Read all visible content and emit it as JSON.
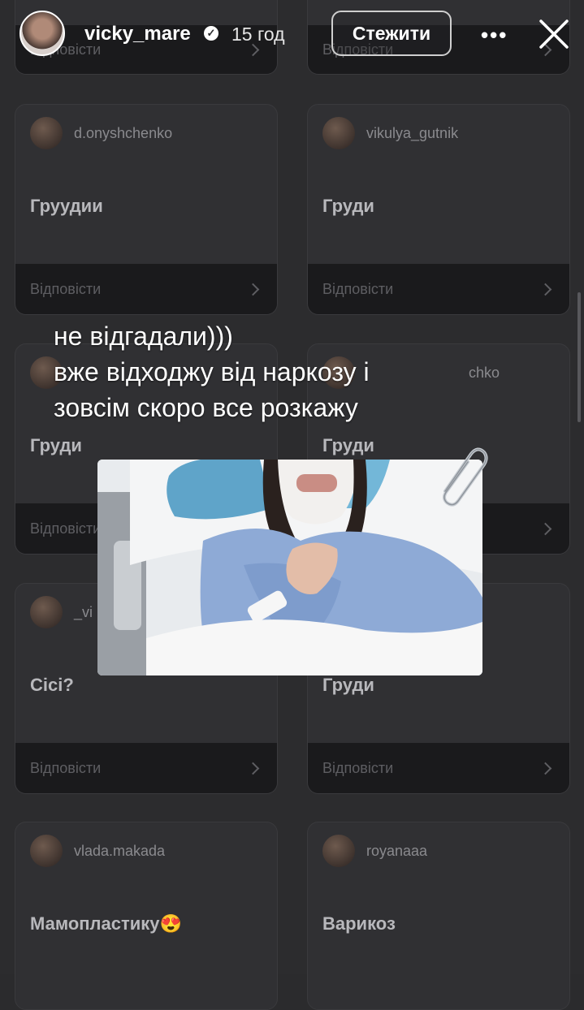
{
  "header": {
    "username": "vicky_mare",
    "time": "15 год",
    "follow_label": "Стежити",
    "more_icon": "more-horizontal-icon",
    "close_icon": "close-icon"
  },
  "overlay": {
    "lines": [
      "не відгадали)))",
      "вже відходжу від наркозу і",
      "зовсім скоро все розкажу"
    ]
  },
  "cards": {
    "reply_label": "Відповісти",
    "items": [
      {
        "user": "d.onyshchenko",
        "answer": "Груудии"
      },
      {
        "user": "vikulya_gutnik",
        "answer": "Груди"
      },
      {
        "user": "",
        "answer": "Груди"
      },
      {
        "user": "chko",
        "answer": "Груди"
      },
      {
        "user": "_vi",
        "answer": "Сісі?"
      },
      {
        "user": "",
        "answer": "Груди"
      },
      {
        "user": "vlada.makada",
        "answer": "Мамопластику😍"
      },
      {
        "user": "royanaaa",
        "answer": "Варикоз"
      }
    ]
  },
  "colors": {
    "background": "#2c2c2e",
    "card": "#303033",
    "reply_bar": "#1a1a1c"
  }
}
